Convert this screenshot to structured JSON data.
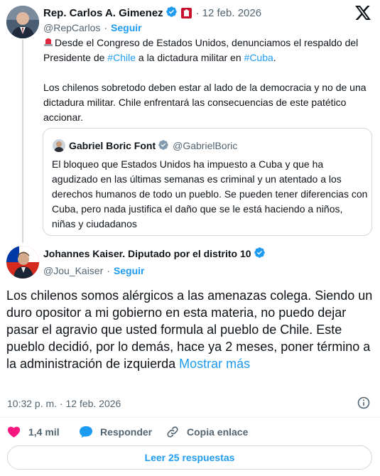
{
  "parent_tweet": {
    "author_name": "Rep. Carlos A. Gimenez",
    "handle": "@RepCarlos",
    "separator": "·",
    "date": "12 feb. 2026",
    "follow_label": "Seguir",
    "text_part1": "Desde el Congreso de Estados Unidos, denunciamos el respaldo del Presidente de ",
    "hashtag_chile": "#Chile",
    "text_part2": " a la dictadura militar en ",
    "hashtag_cuba": "#Cuba",
    "text_part3": ".",
    "paragraph2": "Los chilenos sobretodo deben estar al lado de la democracia y no de una dictadura  militar. Chile enfrentará las consecuencias de este patético accionar."
  },
  "quoted_tweet": {
    "author_name": "Gabriel Boric Font",
    "handle": "@GabrielBoric",
    "text": "El bloqueo que Estados Unidos ha impuesto a Cuba y que ha agudizado en las últimas semanas es criminal y un atentado a los derechos humanos de todo un pueblo. Se pueden tener diferencias con Cuba, pero nada justifica el daño que se le está haciendo a niños, niñas y ciudadanos"
  },
  "main_tweet": {
    "author_name": "Johannes Kaiser. Diputado por el distrito 10",
    "handle": "@Jou_Kaiser",
    "separator": "·",
    "follow_label": "Seguir",
    "text": "Los chilenos somos alérgicos a las amenazas colega. Siendo un duro opositor a mi gobierno en esta materia, no puedo dejar pasar el agravio que usted formula al pueblo de Chile.  Este pueblo decidió, por lo demás, hace ya 2 meses, poner término a la administración de izquierda",
    "show_more": "Mostrar más",
    "timestamp": "10:32 p. m. · 12 feb. 2026"
  },
  "actions": {
    "likes": "1,4 mil",
    "reply_label": "Responder",
    "copy_link_label": "Copia enlace",
    "read_replies": "Leer 25 respuestas"
  },
  "colors": {
    "accent": "#1d9bf0",
    "like_red": "#f91880",
    "gray_text": "#536471",
    "border": "#cfd9de"
  },
  "icons": [
    "verified-badge-icon",
    "us-congress-flag-icon",
    "x-logo-icon",
    "red-light-emoji-icon",
    "info-icon",
    "heart-icon",
    "speech-bubble-icon",
    "link-icon"
  ]
}
